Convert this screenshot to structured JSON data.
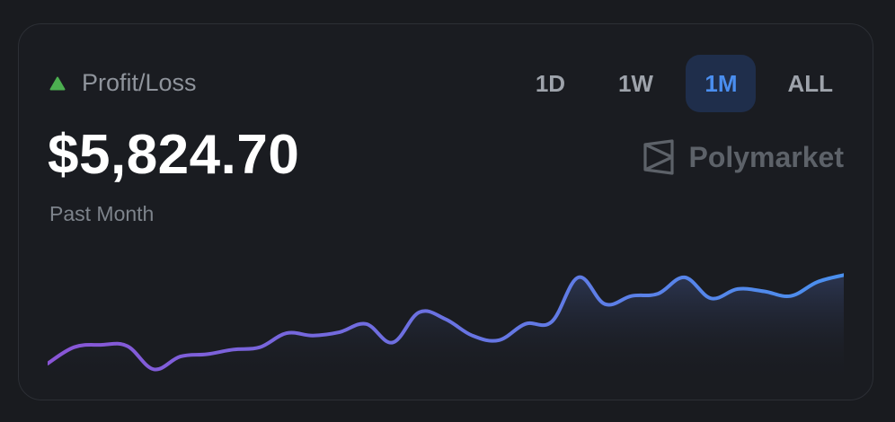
{
  "card": {
    "label": "Profit/Loss",
    "amount": "$5,824.70",
    "period": "Past Month",
    "brand": "Polymarket",
    "colors": {
      "positive": "#4caf50",
      "active_tab_text": "#4a8eef",
      "active_tab_bg": "#1f2e4b",
      "line_start": "#8a55d6",
      "line_end": "#4a90ee"
    },
    "icons": {
      "trend": "triangle-up-icon",
      "brand": "polymarket-logo-icon"
    }
  },
  "range_tabs": [
    {
      "label": "1D",
      "active": false
    },
    {
      "label": "1W",
      "active": false
    },
    {
      "label": "1M",
      "active": true
    },
    {
      "label": "ALL",
      "active": false
    }
  ],
  "chart_data": {
    "type": "area",
    "title": "",
    "xlabel": "",
    "ylabel": "",
    "values": [
      6,
      20,
      22,
      21,
      1,
      12,
      14,
      18,
      20,
      32,
      30,
      33,
      40,
      24,
      50,
      44,
      30,
      26,
      40,
      42,
      80,
      57,
      64,
      66,
      80,
      62,
      70,
      68,
      64,
      76,
      82
    ],
    "ylim": [
      -8,
      100
    ]
  }
}
